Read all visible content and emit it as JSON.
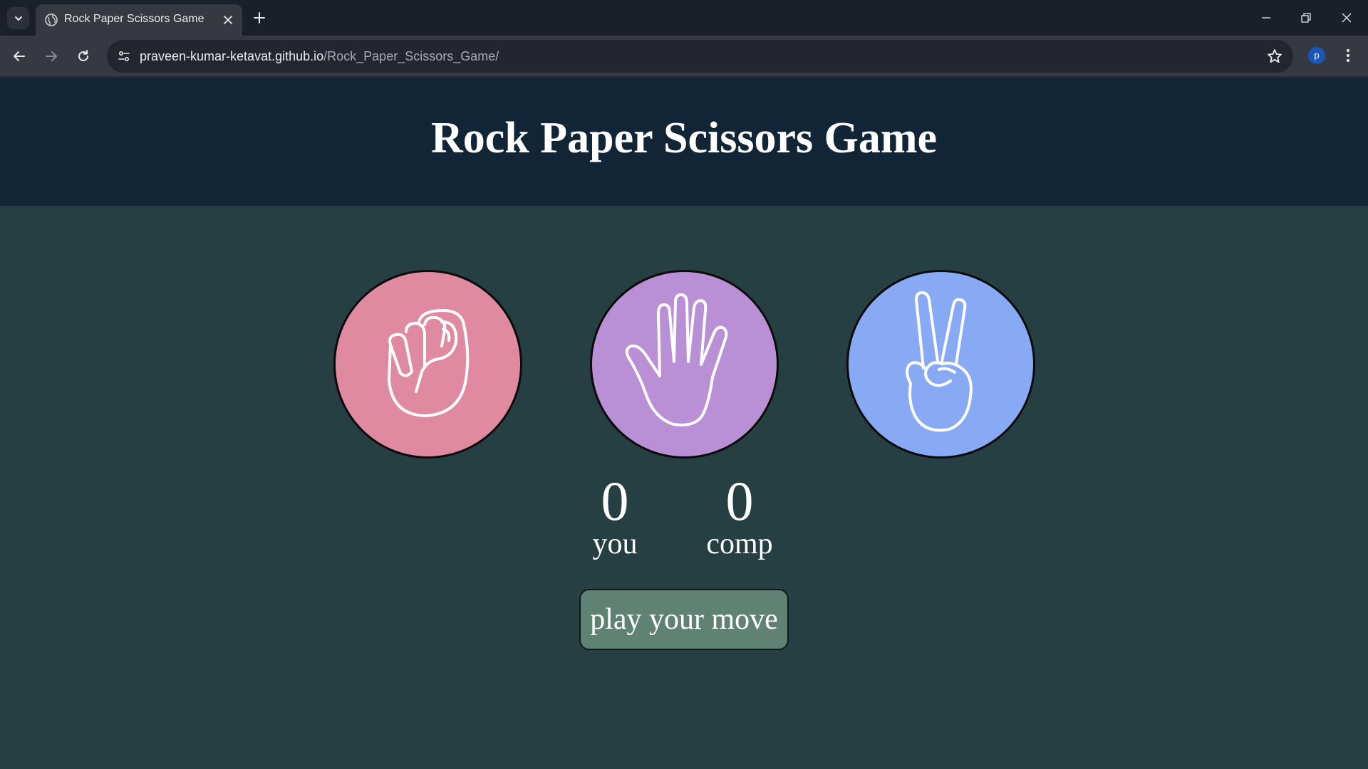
{
  "browser": {
    "tab_title": "Rock Paper Scissors Game",
    "url_host": "praveen-kumar-ketavat.github.io",
    "url_path": "/Rock_Paper_Scissors_Game/",
    "profile_initial": "p"
  },
  "game": {
    "title": "Rock Paper Scissors Game",
    "choices": [
      {
        "id": "rock",
        "color": "#e08aa2",
        "icon": "fist-icon"
      },
      {
        "id": "paper",
        "color": "#b98fd5",
        "icon": "open-hand-icon"
      },
      {
        "id": "scissors",
        "color": "#88aaf5",
        "icon": "peace-hand-icon"
      }
    ],
    "user_score": "0",
    "user_label": "you",
    "comp_score": "0",
    "comp_label": "comp",
    "message": "play your move"
  },
  "colors": {
    "header_bg": "#122536",
    "page_bg": "#263f42",
    "message_bg": "#5f8274"
  }
}
